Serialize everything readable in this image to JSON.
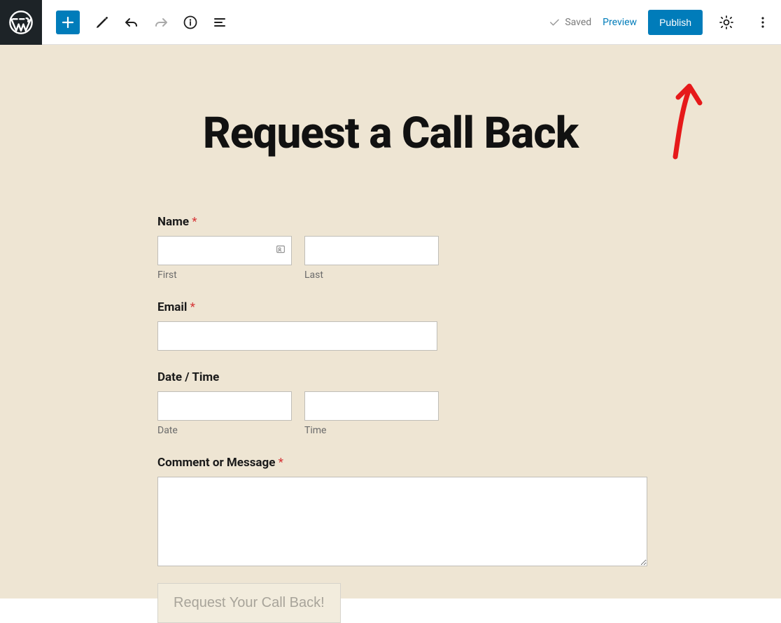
{
  "toolbar": {
    "status": "Saved",
    "preview_label": "Preview",
    "publish_label": "Publish"
  },
  "page": {
    "title": "Request a Call Back"
  },
  "form": {
    "name": {
      "label": "Name",
      "first_sub": "First",
      "last_sub": "Last"
    },
    "email": {
      "label": "Email"
    },
    "datetime": {
      "label": "Date / Time",
      "date_sub": "Date",
      "time_sub": "Time"
    },
    "comment": {
      "label": "Comment or Message"
    },
    "submit_label": "Request Your Call Back!",
    "required_mark": "*"
  }
}
